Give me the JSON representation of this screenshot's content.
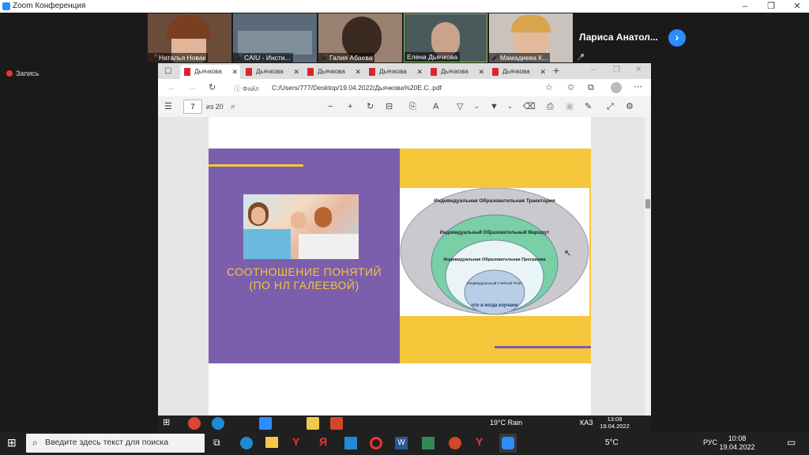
{
  "window": {
    "title": "Zoom Конференция",
    "controls": [
      "–",
      "❐",
      "✕"
    ]
  },
  "participants": [
    {
      "name": "Наталья Новак",
      "bg": "#6b4b3a"
    },
    {
      "name": "CAIU - Инсти...",
      "bg": "#5a6a7a"
    },
    {
      "name": "Галия Абаева",
      "bg": "#9a8070"
    },
    {
      "name": "Елена Дьячкова",
      "bg": "#4a5a5a"
    },
    {
      "name": "Мамадиева К...",
      "bg": "#c9c2bd"
    }
  ],
  "active_speaker": "Лариса  Анатол...",
  "recording_label": "Запись",
  "browser": {
    "tabs": [
      "Дьячкова",
      "Дьячкова",
      "Дьячкова",
      "Дьячкова",
      "Дьячкова",
      "Дьячкова"
    ],
    "address_prefix": "Файл",
    "url": "C:/Users/777/Desktop/19.04.2022/Дьячкова%20Е.С..pdf",
    "page_current": "7",
    "page_total": "из 20"
  },
  "slide": {
    "title": "СООТНОШЕНИЕ ПОНЯТИЙ (ПО НЛ ГАЛЕЕВОЙ)",
    "rings": [
      {
        "label": "Индивидуальная Образовательная Траектория"
      },
      {
        "label": "Индивидуальный Образовательный Маршрут"
      },
      {
        "label": "Индивидуальная Образовательная Программа"
      },
      {
        "label": "Индивидуальный Учебный План"
      }
    ],
    "center_text": "что и когда изучаем"
  },
  "inner_taskbar": {
    "weather": "19°C  Rain",
    "lang": "КАЗ",
    "time": "13:08",
    "date": "19.04.2022"
  },
  "taskbar": {
    "search_placeholder": "Введите здесь текст для поиска",
    "weather": "5°C",
    "lang": "РУС",
    "time": "10:08",
    "date": "19.04.2022"
  },
  "colors": {
    "purple": "#7b5fac",
    "yellow": "#f6c63b",
    "zoom_blue": "#2d8cff"
  }
}
